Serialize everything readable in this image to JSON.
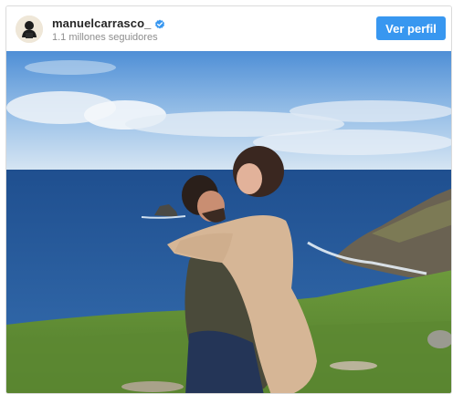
{
  "header": {
    "username": "manuelcarrasco_",
    "followers": "1.1 millones seguidores",
    "profile_button_label": "Ver perfil",
    "verified_icon": "verified-badge-icon",
    "avatar_icon": "profile-avatar"
  },
  "colors": {
    "accent": "#3897f0",
    "username": "#262626",
    "secondary_text": "#8e8e8e"
  },
  "photo": {
    "description_icon": "couple-embracing-by-sea-photo"
  }
}
